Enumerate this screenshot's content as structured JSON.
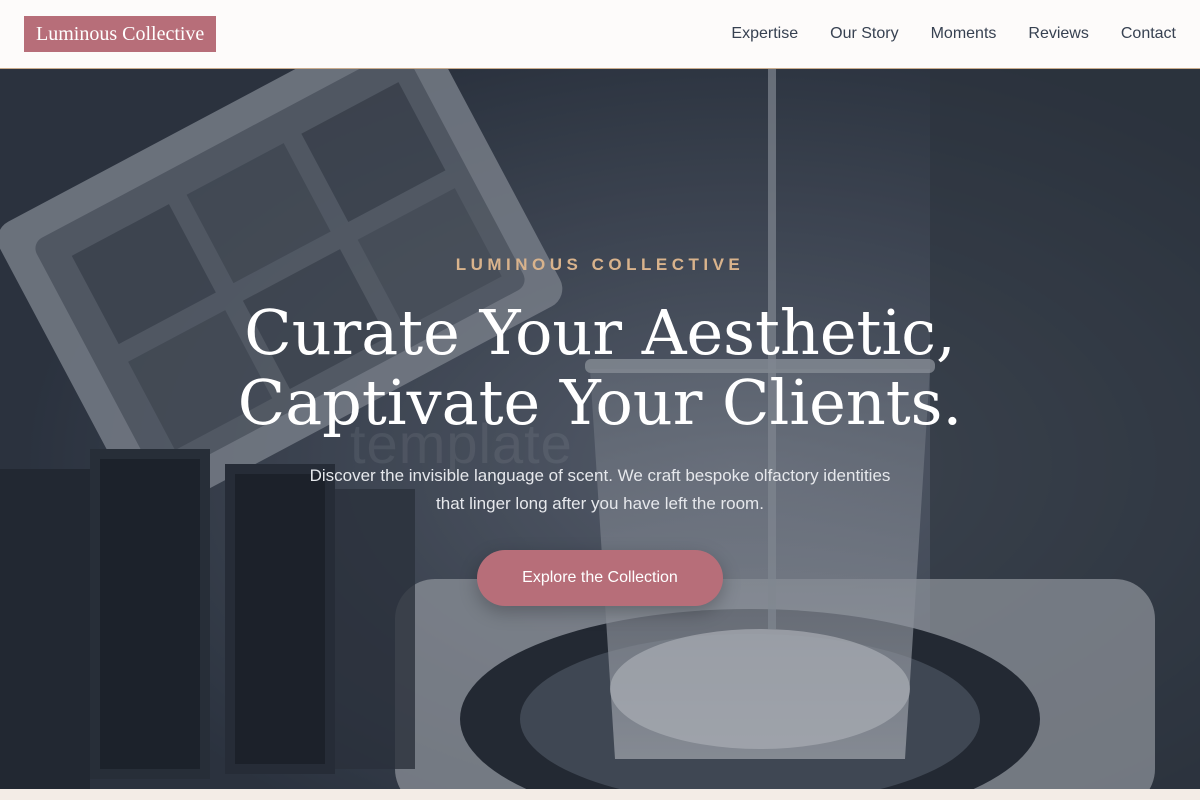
{
  "header": {
    "logo_text": "Luminous Collective",
    "nav": [
      {
        "label": "Expertise"
      },
      {
        "label": "Our Story"
      },
      {
        "label": "Moments"
      },
      {
        "label": "Reviews"
      },
      {
        "label": "Contact"
      }
    ]
  },
  "hero": {
    "eyebrow": "LUMINOUS COLLECTIVE",
    "headline_line1": "Curate Your Aesthetic,",
    "headline_line2": "Captivate Your Clients.",
    "subtext_line1": "Discover the invisible language of scent. We craft bespoke olfactory identities",
    "subtext_line2": "that linger long after you have left the room.",
    "cta_label": "Explore the Collection",
    "watermark": "template"
  },
  "colors": {
    "accent": "#b76e79",
    "eyebrow": "#d9b38c",
    "overlay": "#2f3744"
  }
}
